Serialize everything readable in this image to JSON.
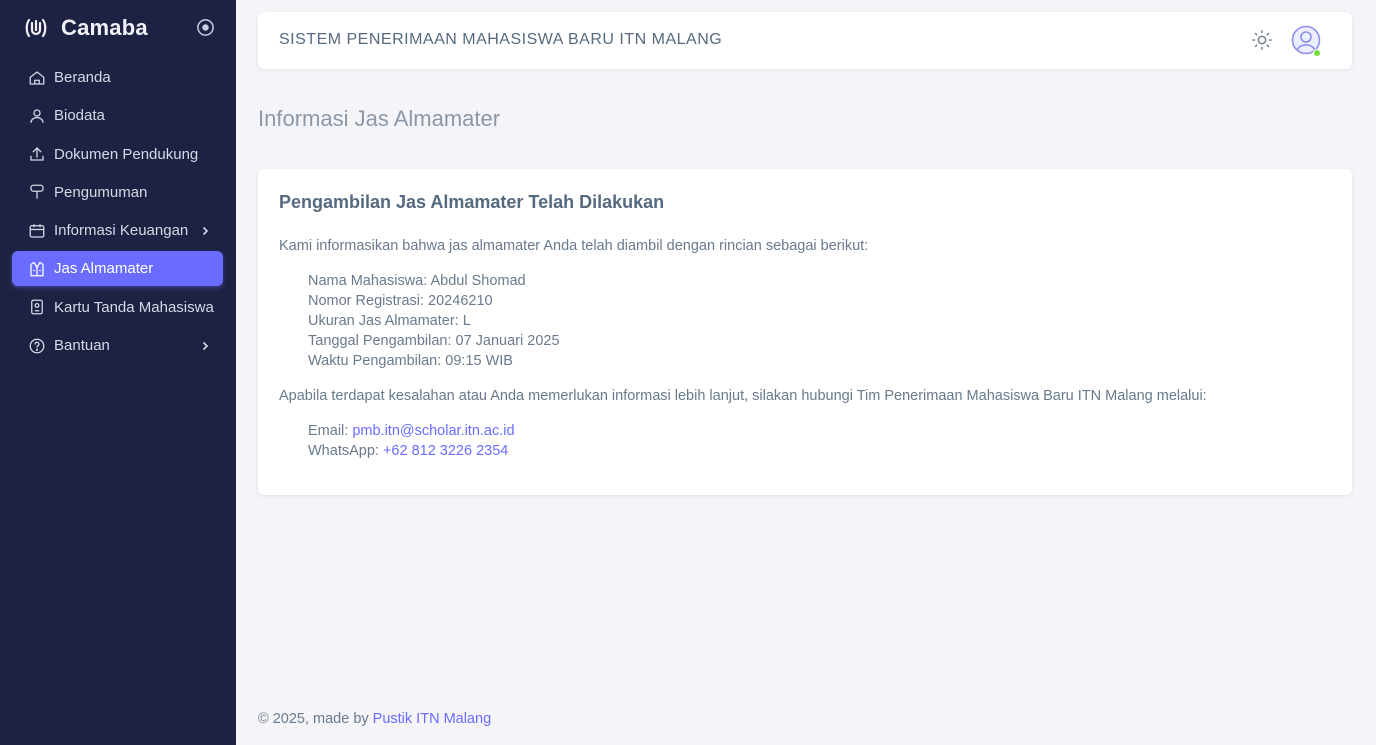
{
  "brand": {
    "name": "Camaba"
  },
  "sidebar": {
    "items": [
      {
        "label": "Beranda",
        "icon": "home-icon"
      },
      {
        "label": "Biodata",
        "icon": "user-icon"
      },
      {
        "label": "Dokumen Pendukung",
        "icon": "upload-icon"
      },
      {
        "label": "Pengumuman",
        "icon": "announcement-icon"
      },
      {
        "label": "Informasi Keuangan",
        "icon": "finance-icon",
        "has_submenu": true
      },
      {
        "label": "Jas Almamater",
        "icon": "jacket-icon",
        "active": true
      },
      {
        "label": "Kartu Tanda Mahasiswa",
        "icon": "id-card-icon"
      },
      {
        "label": "Bantuan",
        "icon": "help-icon",
        "has_submenu": true
      }
    ]
  },
  "navbar": {
    "title": "SISTEM PENERIMAAN MAHASISWA BARU ITN MALANG"
  },
  "page": {
    "title": "Informasi Jas Almamater"
  },
  "card": {
    "title": "Pengambilan Jas Almamater Telah Dilakukan",
    "intro": "Kami informasikan bahwa jas almamater Anda telah diambil dengan rincian sebagai berikut:",
    "details": [
      "Nama Mahasiswa: Abdul Shomad",
      "Nomor Registrasi: 20246210",
      "Ukuran Jas Almamater: L",
      "Tanggal Pengambilan: 07 Januari 2025",
      "Waktu Pengambilan: 09:15 WIB"
    ],
    "contact_text": "Apabila terdapat kesalahan atau Anda memerlukan informasi lebih lanjut, silakan hubungi Tim Penerimaan Mahasiswa Baru ITN Malang melalui:",
    "contacts": {
      "email_label": "Email: ",
      "email_value": "pmb.itn@scholar.itn.ac.id",
      "whatsapp_label": "WhatsApp: ",
      "whatsapp_value": "+62 812 3226 2354"
    }
  },
  "footer": {
    "text": "© 2025, made by ",
    "link": "Pustik ITN Malang"
  },
  "colors": {
    "accent": "#696cff",
    "sidebar_bg": "#1e2242",
    "online": "#71dd37"
  }
}
